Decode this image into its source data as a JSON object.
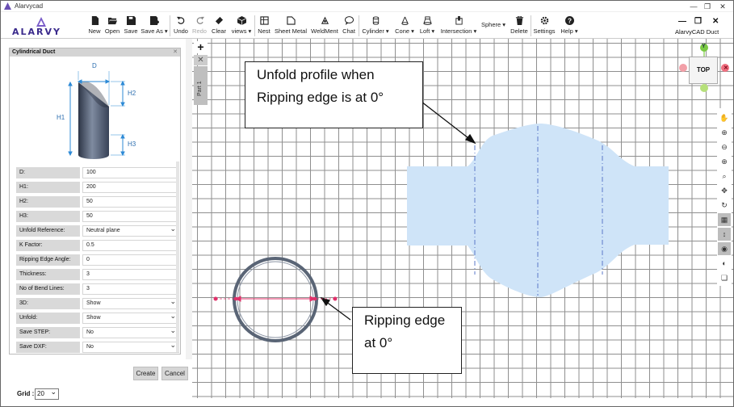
{
  "window": {
    "title": "Alarvycad"
  },
  "brand": {
    "name": "ALARVY"
  },
  "toolbar": {
    "items": [
      {
        "label": "New",
        "icon": "new-file-icon"
      },
      {
        "label": "Open",
        "icon": "open-folder-icon"
      },
      {
        "label": "Save",
        "icon": "save-icon"
      },
      {
        "label": "Save As ▾",
        "icon": "save-as-icon"
      },
      {
        "label": "Undo",
        "icon": "undo-icon"
      },
      {
        "label": "Redo",
        "icon": "redo-icon"
      },
      {
        "label": "Clear",
        "icon": "eraser-icon"
      },
      {
        "label": "views ▾",
        "icon": "cube-icon"
      },
      {
        "label": "Nest",
        "icon": "nest-icon"
      },
      {
        "label": "Sheet Metal",
        "icon": "sheet-metal-icon"
      },
      {
        "label": "WeldMent",
        "icon": "weldment-icon"
      },
      {
        "label": "Chat",
        "icon": "chat-icon"
      },
      {
        "label": "Cylinder ▾",
        "icon": "cylinder-icon"
      },
      {
        "label": "Cone ▾",
        "icon": "cone-icon"
      },
      {
        "label": "Loft ▾",
        "icon": "loft-icon"
      },
      {
        "label": "Intersection ▾",
        "icon": "intersection-icon"
      },
      {
        "label": "Sphere ▾",
        "icon": "sphere-icon"
      },
      {
        "label": "Delete",
        "icon": "trash-icon"
      },
      {
        "label": "Settings",
        "icon": "gear-icon"
      },
      {
        "label": "Help ▾",
        "icon": "help-icon"
      }
    ],
    "document_name": "AlarvyCAD Duct"
  },
  "panel": {
    "title": "Cylindrical Duct",
    "diagram_labels": {
      "d": "D",
      "h1": "H1",
      "h2": "H2",
      "h3": "H3"
    },
    "fields": [
      {
        "label": "D:",
        "value": "100"
      },
      {
        "label": "H1:",
        "value": "200"
      },
      {
        "label": "H2:",
        "value": "50"
      },
      {
        "label": "H3:",
        "value": "50"
      },
      {
        "label": "Unfold Reference:",
        "value": "Neutral plane"
      },
      {
        "label": "K Factor:",
        "value": "0.5"
      },
      {
        "label": "Ripping Edge Angle:",
        "value": "0"
      },
      {
        "label": "Thickness:",
        "value": "3"
      },
      {
        "label": "No of Bend Lines:",
        "value": "3"
      },
      {
        "label": "3D:",
        "value": "Show"
      },
      {
        "label": "Unfold:",
        "value": "Show"
      },
      {
        "label": "Save STEP:",
        "value": "No"
      },
      {
        "label": "Save DXF:",
        "value": "No"
      }
    ],
    "create_label": "Create",
    "cancel_label": "Cancel"
  },
  "canvas": {
    "part_tab": "Part 1",
    "view_cube_label": "TOP",
    "axis_y_label": "Y",
    "callout_unfold": "Unfold profile when Ripping edge is at 0°",
    "callout_ripping": "Ripping edge at 0°"
  },
  "statusbar": {
    "grid_label": "Grid :",
    "grid_value": "20"
  },
  "colors": {
    "unfold_fill": "#cfe4f8",
    "bend_line": "#5b78c8",
    "ripping_marker": "#e0306a",
    "ring": "#5a6576"
  }
}
